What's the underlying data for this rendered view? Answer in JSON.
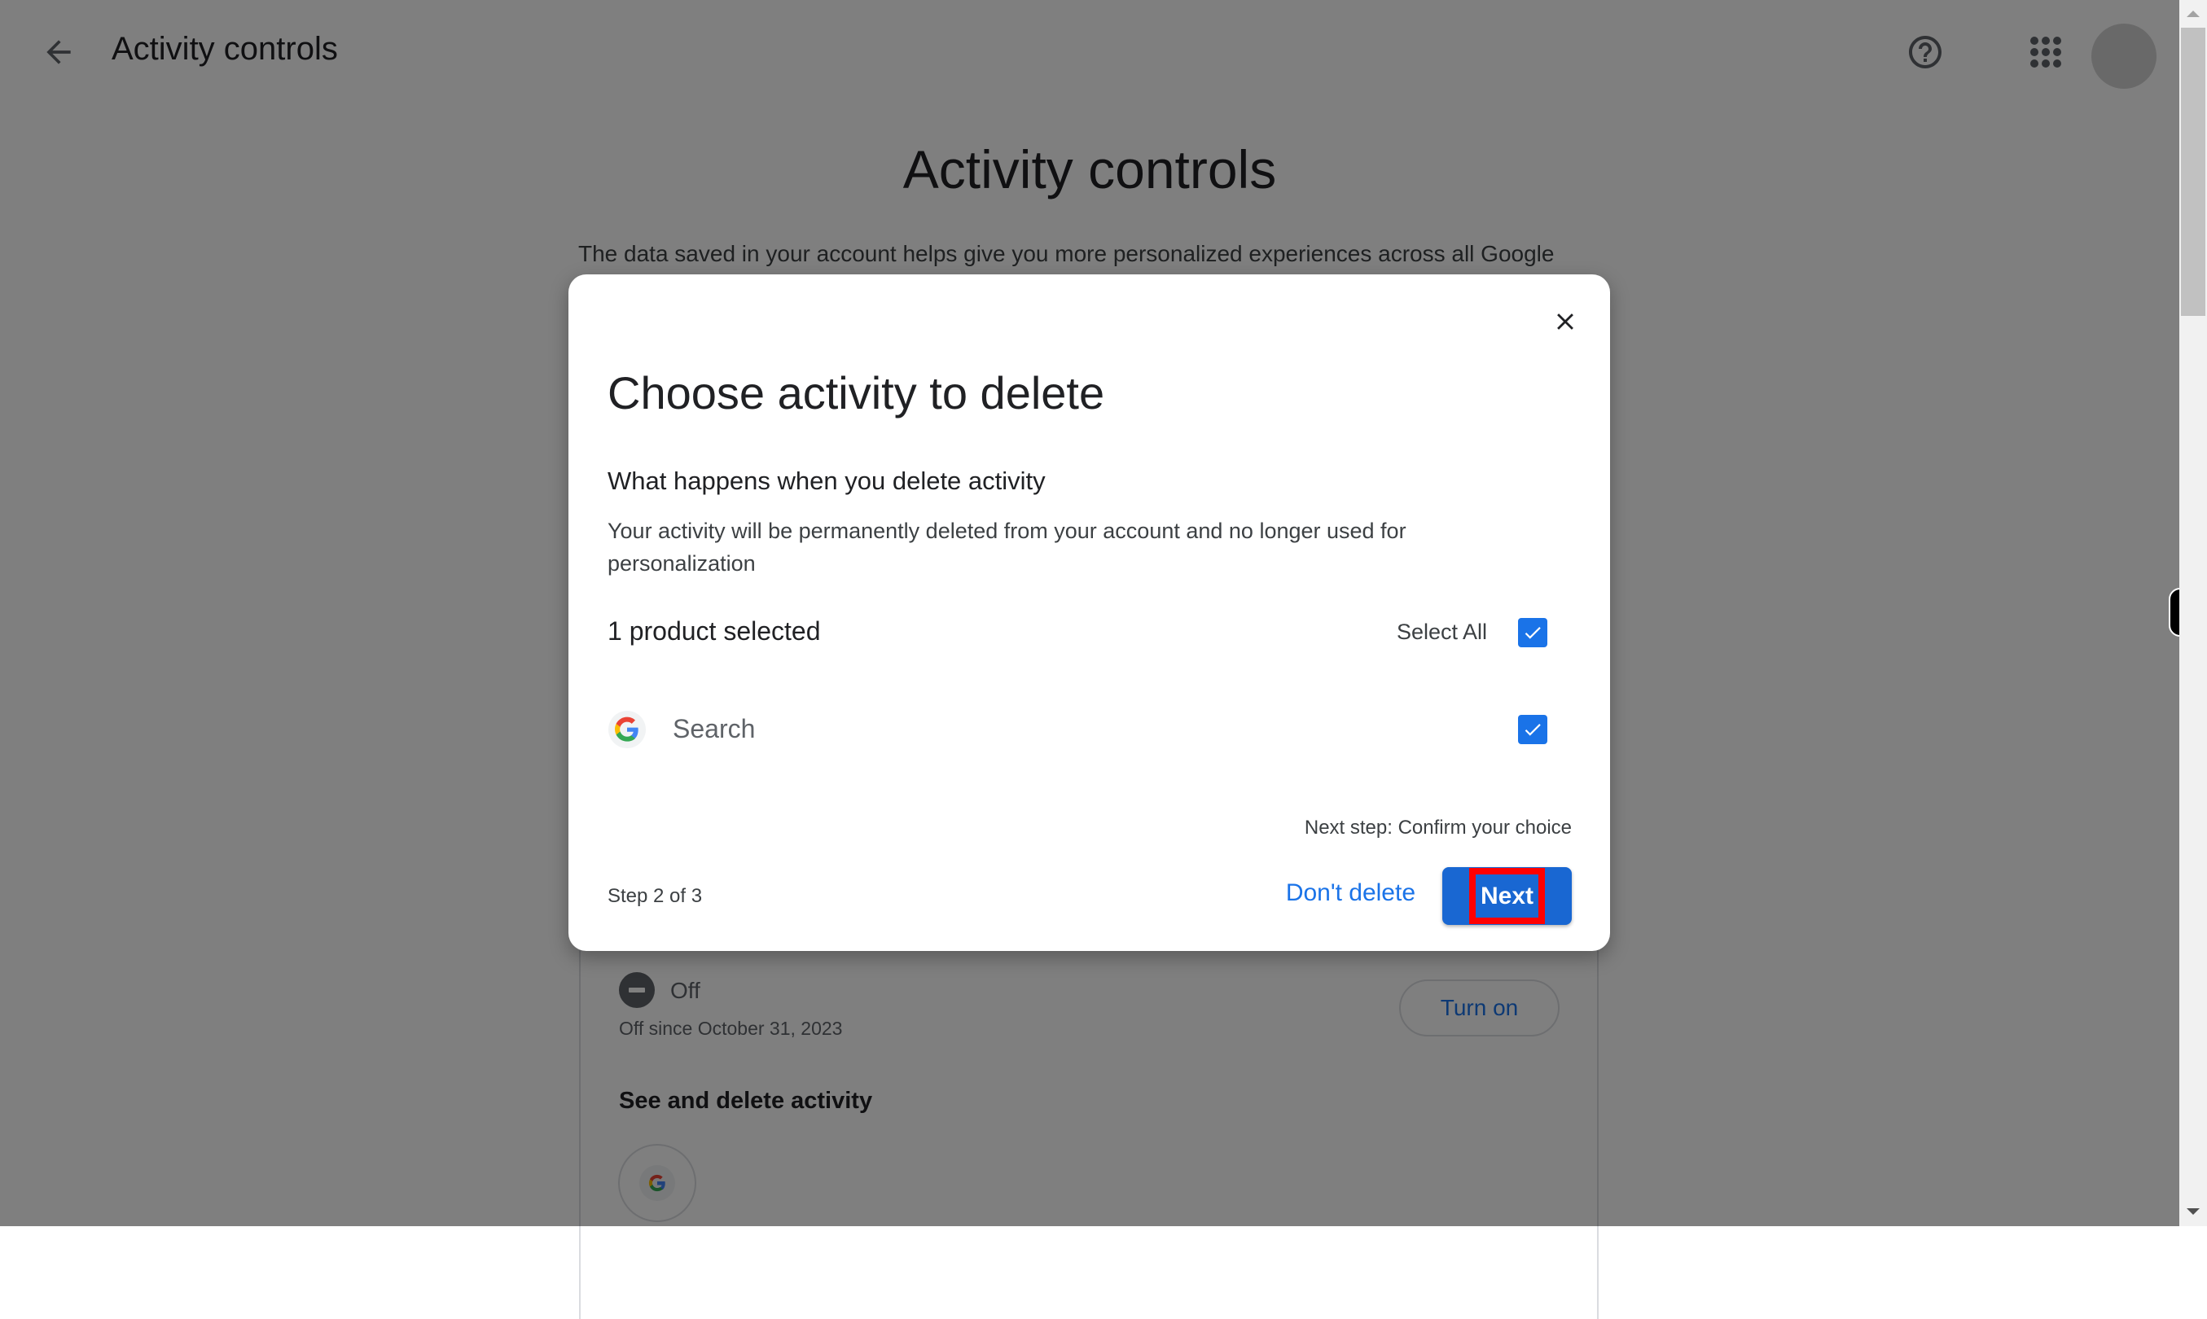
{
  "header": {
    "title": "Activity controls",
    "back_icon": "arrow-back-icon",
    "help_icon": "help-circle-icon",
    "apps_icon": "apps-grid-icon",
    "avatar_icon": "account-avatar"
  },
  "page": {
    "title": "Activity controls",
    "description": "The data saved in your account helps give you more personalized experiences across all Google"
  },
  "background_card": {
    "status_label": "Off",
    "status_since": "Off since October 31, 2023",
    "turn_on_label": "Turn on",
    "see_delete_heading": "See and delete activity"
  },
  "dialog": {
    "title": "Choose activity to delete",
    "subheading": "What happens when you delete activity",
    "body": "Your activity will be permanently deleted from your account and no longer used for personalization",
    "selected_count": "1 product selected",
    "select_all_label": "Select All",
    "select_all_checked": true,
    "products": [
      {
        "name": "Search",
        "icon": "google-g-icon",
        "checked": true
      }
    ],
    "next_step_text": "Next step: Confirm your choice",
    "step_text": "Step 2 of 3",
    "cancel_label": "Don't delete",
    "next_label": "Next"
  },
  "colors": {
    "accent": "#1a73e8",
    "primary_button": "#1967d2",
    "highlight": "#ff0000",
    "scrim": "#000000"
  }
}
